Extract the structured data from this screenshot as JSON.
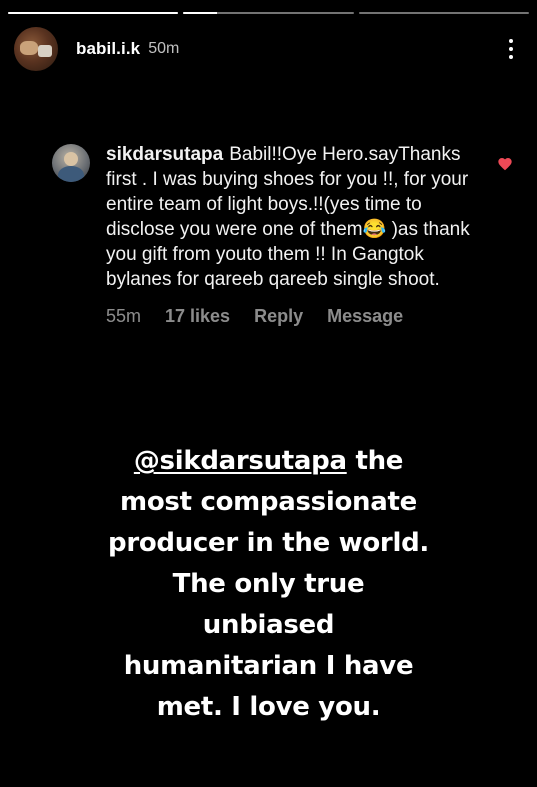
{
  "story": {
    "progress": [
      1,
      0.2,
      0
    ]
  },
  "header": {
    "username": "babil.i.k",
    "time": "50m",
    "more_icon": "more-vertical-icon"
  },
  "comment": {
    "username": "sikdarsutapa",
    "text": "Babil!!Oye Hero.sayThanks first . I was buying shoes for you !!, for your entire team of light boys.!!(yes time to disclose you were one of them😂 )as thank you gift from youto them !! In Gangtok bylanes for qareeb qareeb single shoot.",
    "time": "55m",
    "likes": "17 likes",
    "reply_label": "Reply",
    "message_label": "Message",
    "liked": true,
    "heart_color": "#ed4956"
  },
  "caption": {
    "mention": "@sikdarsutapa",
    "lines": [
      " the",
      "most compassionate",
      "producer in the world.",
      "The only true",
      "unbiased",
      "humanitarian I have",
      "met. I love you."
    ]
  }
}
